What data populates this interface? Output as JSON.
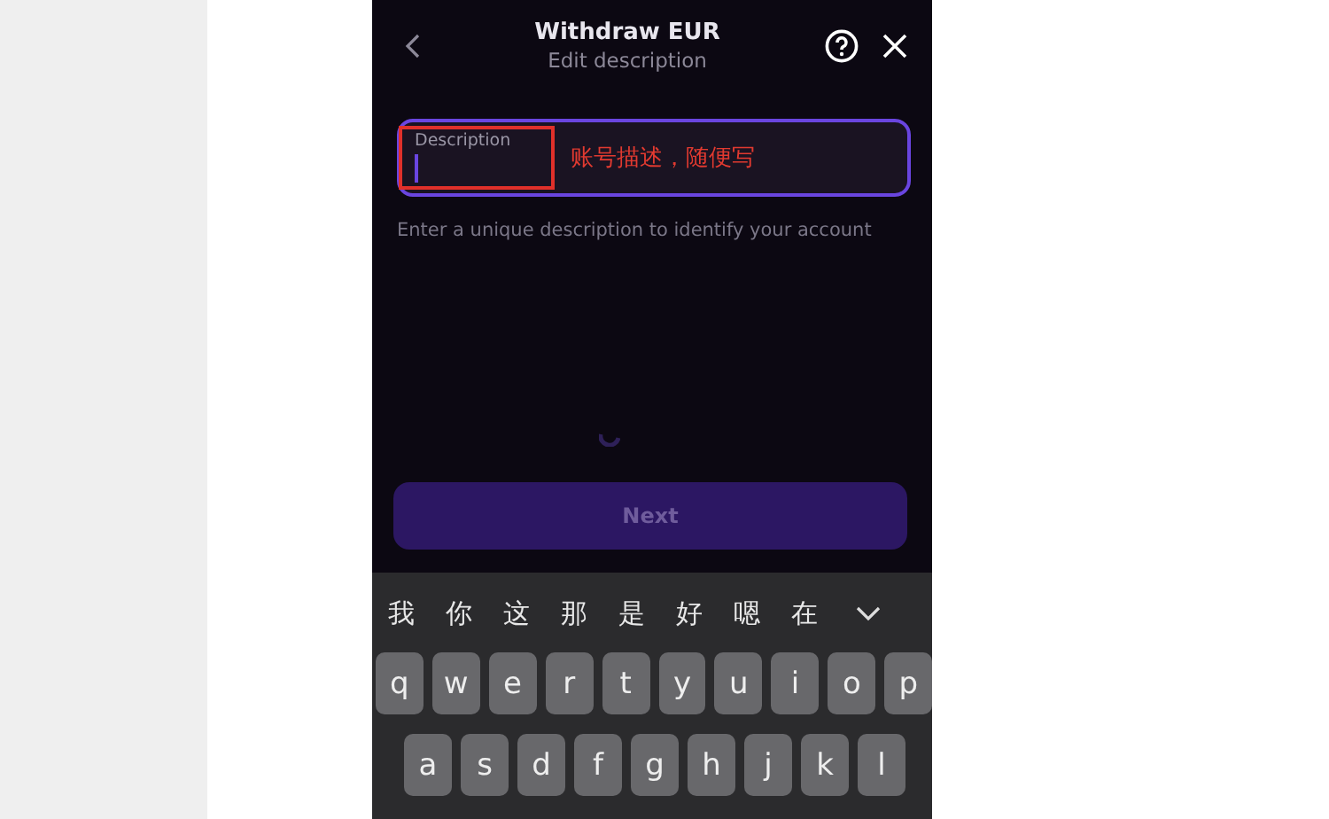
{
  "header": {
    "title": "Withdraw EUR",
    "subtitle": "Edit description"
  },
  "field": {
    "label": "Description",
    "focused": true
  },
  "annotation": {
    "text": "账号描述，随便写"
  },
  "helper_text": "Enter a unique description to identify your account",
  "next_button": {
    "label": "Next",
    "disabled": true
  },
  "keyboard": {
    "candidates": [
      "我",
      "你",
      "这",
      "那",
      "是",
      "好",
      "嗯",
      "在"
    ],
    "rows": [
      [
        "q",
        "w",
        "e",
        "r",
        "t",
        "y",
        "u",
        "i",
        "o",
        "p"
      ],
      [
        "a",
        "s",
        "d",
        "f",
        "g",
        "h",
        "j",
        "k",
        "l"
      ]
    ]
  }
}
